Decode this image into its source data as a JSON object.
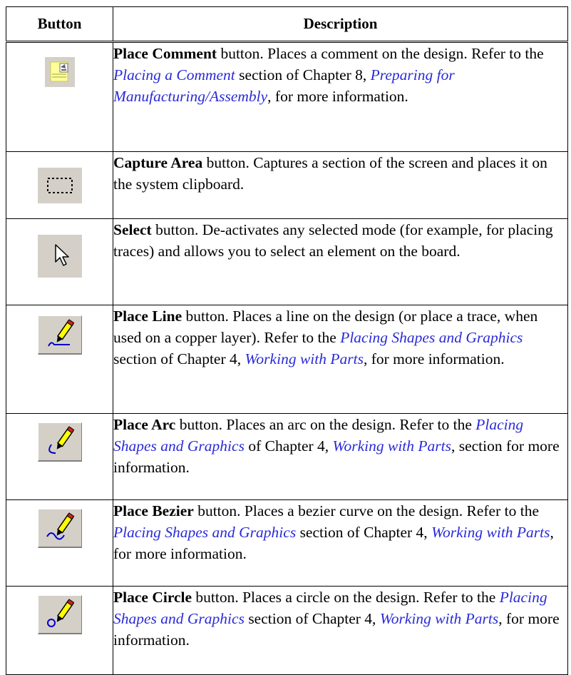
{
  "table": {
    "headers": {
      "button": "Button",
      "description": "Description"
    },
    "rows": [
      {
        "icon": "place-comment-icon",
        "segments": [
          {
            "text": "Place Comment",
            "style": "bold"
          },
          {
            "text": " button. Places a comment on the design. Refer to the ",
            "style": "plain"
          },
          {
            "text": "Placing a Comment",
            "style": "link"
          },
          {
            "text": " section of Chapter 8, ",
            "style": "plain"
          },
          {
            "text": "Preparing for Manufacturing/Assembly",
            "style": "link"
          },
          {
            "text": ", for more information.",
            "style": "plain"
          }
        ]
      },
      {
        "icon": "capture-area-icon",
        "segments": [
          {
            "text": "Capture Area",
            "style": "bold"
          },
          {
            "text": " button. Captures a section of the screen and places it on the system clipboard.",
            "style": "plain"
          }
        ]
      },
      {
        "icon": "select-arrow-icon",
        "segments": [
          {
            "text": "Select",
            "style": "bold"
          },
          {
            "text": " button. De-activates any selected mode (for example, for placing traces) and allows you to select an element on the board.",
            "style": "plain"
          }
        ]
      },
      {
        "icon": "place-line-icon",
        "segments": [
          {
            "text": "Place Line",
            "style": "bold"
          },
          {
            "text": " button. Places a line on the design (or place a trace, when used on a copper layer). Refer to the ",
            "style": "plain"
          },
          {
            "text": "Placing Shapes and Graphics",
            "style": "link"
          },
          {
            "text": " section of Chapter 4, ",
            "style": "plain"
          },
          {
            "text": "Working with Parts",
            "style": "link"
          },
          {
            "text": ", for more information.",
            "style": "plain"
          }
        ]
      },
      {
        "icon": "place-arc-icon",
        "segments": [
          {
            "text": "Place Arc",
            "style": "bold"
          },
          {
            "text": " button. Places an arc on the design. Refer to the ",
            "style": "plain"
          },
          {
            "text": "Placing Shapes and Graphics",
            "style": "link"
          },
          {
            "text": " of Chapter 4, ",
            "style": "plain"
          },
          {
            "text": "Working with Parts",
            "style": "link"
          },
          {
            "text": ", section for more information.",
            "style": "plain"
          }
        ]
      },
      {
        "icon": "place-bezier-icon",
        "segments": [
          {
            "text": "Place Bezier",
            "style": "bold"
          },
          {
            "text": " button. Places a bezier curve on the design. Refer to the ",
            "style": "plain"
          },
          {
            "text": "Placing Shapes and Graphics",
            "style": "link"
          },
          {
            "text": " section of Chapter 4, ",
            "style": "plain"
          },
          {
            "text": "Working with Parts",
            "style": "link"
          },
          {
            "text": ", for more information.",
            "style": "plain"
          }
        ]
      },
      {
        "icon": "place-circle-icon",
        "segments": [
          {
            "text": "Place Circle",
            "style": "bold"
          },
          {
            "text": " button. Places a circle on the design. Refer to the ",
            "style": "plain"
          },
          {
            "text": "Placing Shapes and Graphics",
            "style": "link"
          },
          {
            "text": " section of Chapter 4, ",
            "style": "plain"
          },
          {
            "text": "Working with Parts",
            "style": "link"
          },
          {
            "text": ", for more information.",
            "style": "plain"
          }
        ]
      }
    ]
  },
  "colors": {
    "link": "#2a2ad8",
    "button_face": "#d4d0c8",
    "comment_yellow": "#ffff99"
  }
}
